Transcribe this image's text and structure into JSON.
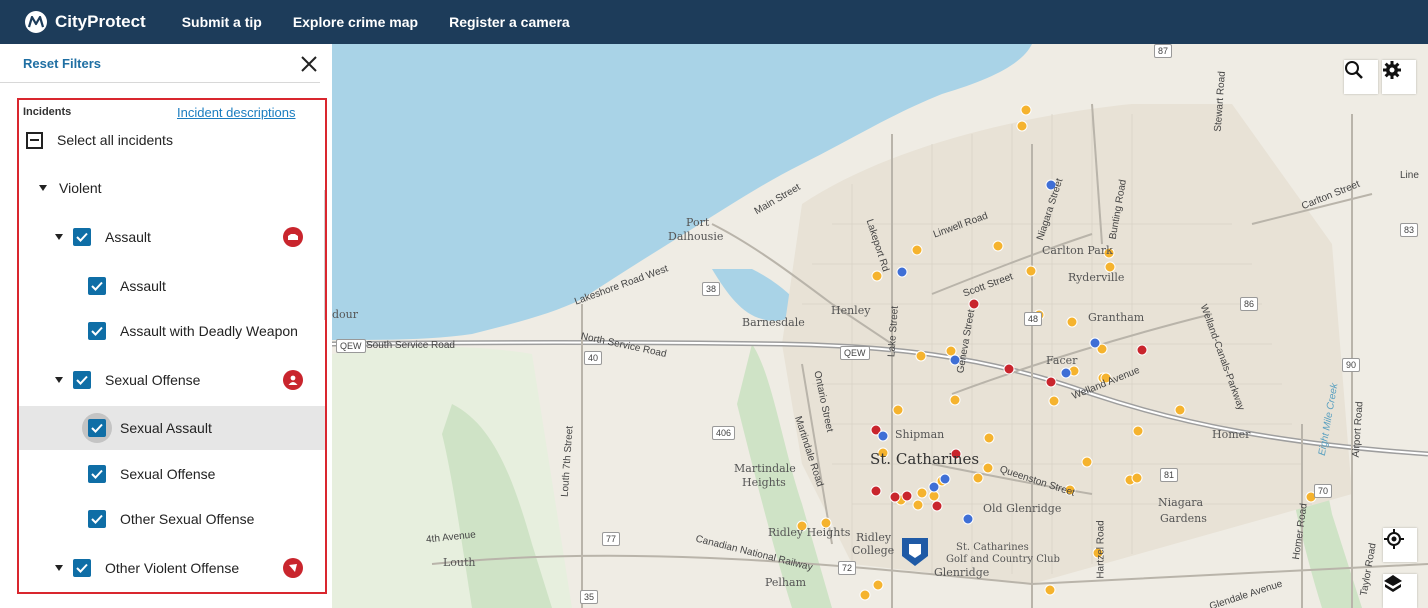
{
  "nav": {
    "brand": "CityProtect",
    "links": [
      "Submit a tip",
      "Explore crime map",
      "Register a camera"
    ]
  },
  "sidebar": {
    "reset_filters": "Reset Filters",
    "incidents_label": "Incidents",
    "incident_descriptions_link": "Incident descriptions",
    "select_all": "Select all incidents",
    "violent": "Violent",
    "assault_group": "Assault",
    "assault": "Assault",
    "assault_deadly": "Assault with Deadly Weapon",
    "sexual_offense_group": "Sexual Offense",
    "sexual_assault": "Sexual Assault",
    "sexual_offense": "Sexual Offense",
    "other_sexual_offense": "Other Sexual Offense",
    "other_violent_offense": "Other Violent Offense"
  },
  "map": {
    "places": {
      "port_dalhousie": "Port\nDalhousie",
      "barnesdale": "Barnesdale",
      "henley": "Henley",
      "shipman": "Shipman",
      "st_catharines": "St. Catharines",
      "martindale_heights": "Martindale\nHeights",
      "ridley_heights": "Ridley Heights",
      "ridley_college": "Ridley\nCollege",
      "louth": "Louth",
      "pelham": "Pelham",
      "glenridge": "Glenridge",
      "old_glenridge": "Old Glenridge",
      "golf_club": "St. Catharines\nGolf and Country Club",
      "niagara_gardens": "Niagara\nGardens",
      "carlton_park": "Carlton Park",
      "ryderville": "Ryderville",
      "grantham": "Grantham",
      "facer": "Facer",
      "homer": "Homer",
      "dour": "dour"
    },
    "roads": {
      "main_street": "Main Street",
      "lakeshore_road_west": "Lakeshore Road West",
      "south_service_road": "South Service Road",
      "north_service_road": "North Service Road",
      "lakeport_rd": "Lakeport Rd",
      "linwell_road": "Linwell Road",
      "niagara_street": "Niagara Street",
      "bunting_road": "Bunting Road",
      "scott_street": "Scott Street",
      "geneva_street": "Geneva Street",
      "lake_street": "Lake Street",
      "ontario_street": "Ontario Street",
      "martindale_road": "Martindale Road",
      "louth_7th_street": "Louth 7th Street",
      "fourth_avenue": "4th Avenue",
      "canadian_national_railway": "Canadian National Railway",
      "queenston_street": "Queenston Street",
      "welland_avenue": "Welland Avenue",
      "welland_canals_parkway": "Welland-Canals-Parkway",
      "stewart_road": "Stewart Road",
      "carlton_street": "Carlton Street",
      "airport_road": "Airport Road",
      "homer_road": "Homer Road",
      "taylor_road": "Taylor Road",
      "hartzel_road": "Hartzel Road",
      "eight_mile_creek": "Eight Mile Creek",
      "glendale_avenue": "Glendale Avenue",
      "qew": "QEW",
      "line": "Line"
    },
    "route_numbers": [
      "87",
      "38",
      "40",
      "406",
      "48",
      "83",
      "86",
      "90",
      "81",
      "70",
      "72",
      "77",
      "35"
    ],
    "colors": {
      "water": "#a9d3e7",
      "land": "#efece4",
      "green": "#cfe3c6",
      "incident_orange": "#f5b32e",
      "incident_red": "#c9252d",
      "incident_blue": "#3f6fd6"
    }
  }
}
